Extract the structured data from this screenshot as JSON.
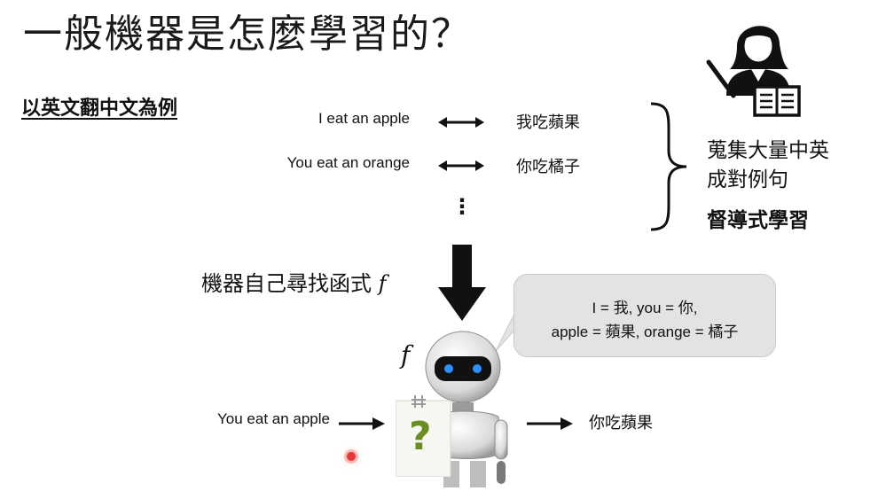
{
  "slide": {
    "title": "一般機器是怎麼學習的？",
    "subtitle": "以英文翻中文為例"
  },
  "pairs": [
    {
      "en": "I eat an apple",
      "zh": "我吃蘋果"
    },
    {
      "en": "You eat an orange",
      "zh": "你吃橘子"
    }
  ],
  "ellipsis": "⋮",
  "notes": {
    "line1": "蒐集大量中英",
    "line2": "成對例句",
    "line3": "督導式學習"
  },
  "finder": {
    "text": "機器自己尋找函式 ",
    "symbol": "f"
  },
  "bubble": {
    "line1": "I = 我, you = 你,",
    "line2": "apple = 蘋果, orange = 橘子"
  },
  "robot_symbol": "f",
  "card_symbol": "?",
  "example": {
    "input": "You eat an apple",
    "output": "你吃蘋果"
  },
  "icons": [
    "teacher-icon",
    "robot-image",
    "question-card-icon"
  ],
  "colors": {
    "card_question": "#6b8e23",
    "robot_eyes": "#2f8fff",
    "pointer": "#e53935"
  }
}
